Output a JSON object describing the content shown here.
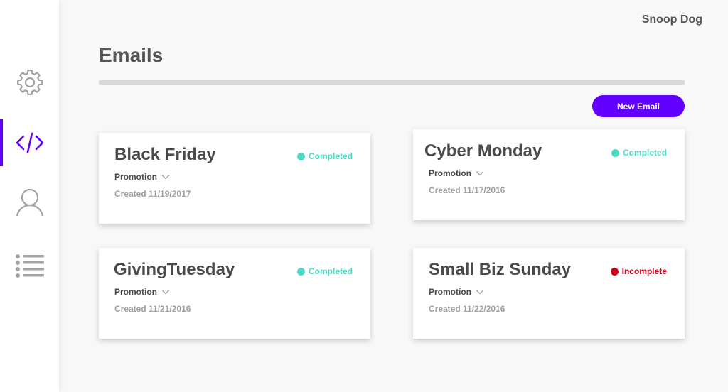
{
  "theme": {
    "accent": "#6200ff",
    "icon_gray": "#a3a3a3",
    "completed_color": "#4dd9c3",
    "incomplete_color": "#d0021b"
  },
  "sidebar": {
    "items": [
      {
        "name": "settings",
        "icon": "gear-icon",
        "active": false
      },
      {
        "name": "code",
        "icon": "code-icon",
        "active": true
      },
      {
        "name": "profile",
        "icon": "user-icon",
        "active": false
      },
      {
        "name": "list",
        "icon": "list-icon",
        "active": false
      }
    ]
  },
  "header": {
    "user_name": "Snoop Dog",
    "title": "Emails"
  },
  "toolbar": {
    "new_email_label": "New Email"
  },
  "cards": [
    {
      "title": "Black Friday",
      "status": "Completed",
      "status_type": "completed",
      "category": "Promotion",
      "created": "Created 11/19/2017"
    },
    {
      "title": "Cyber Monday",
      "status": "Completed",
      "status_type": "completed",
      "category": "Promotion",
      "created": "Created 11/17/2016"
    },
    {
      "title": "GivingTuesday",
      "status": "Completed",
      "status_type": "completed",
      "category": "Promotion",
      "created": "Created 11/21/2016"
    },
    {
      "title": "Small Biz Sunday",
      "status": "Incomplete",
      "status_type": "incomplete",
      "category": "Promotion",
      "created": "Created 11/22/2016"
    }
  ]
}
